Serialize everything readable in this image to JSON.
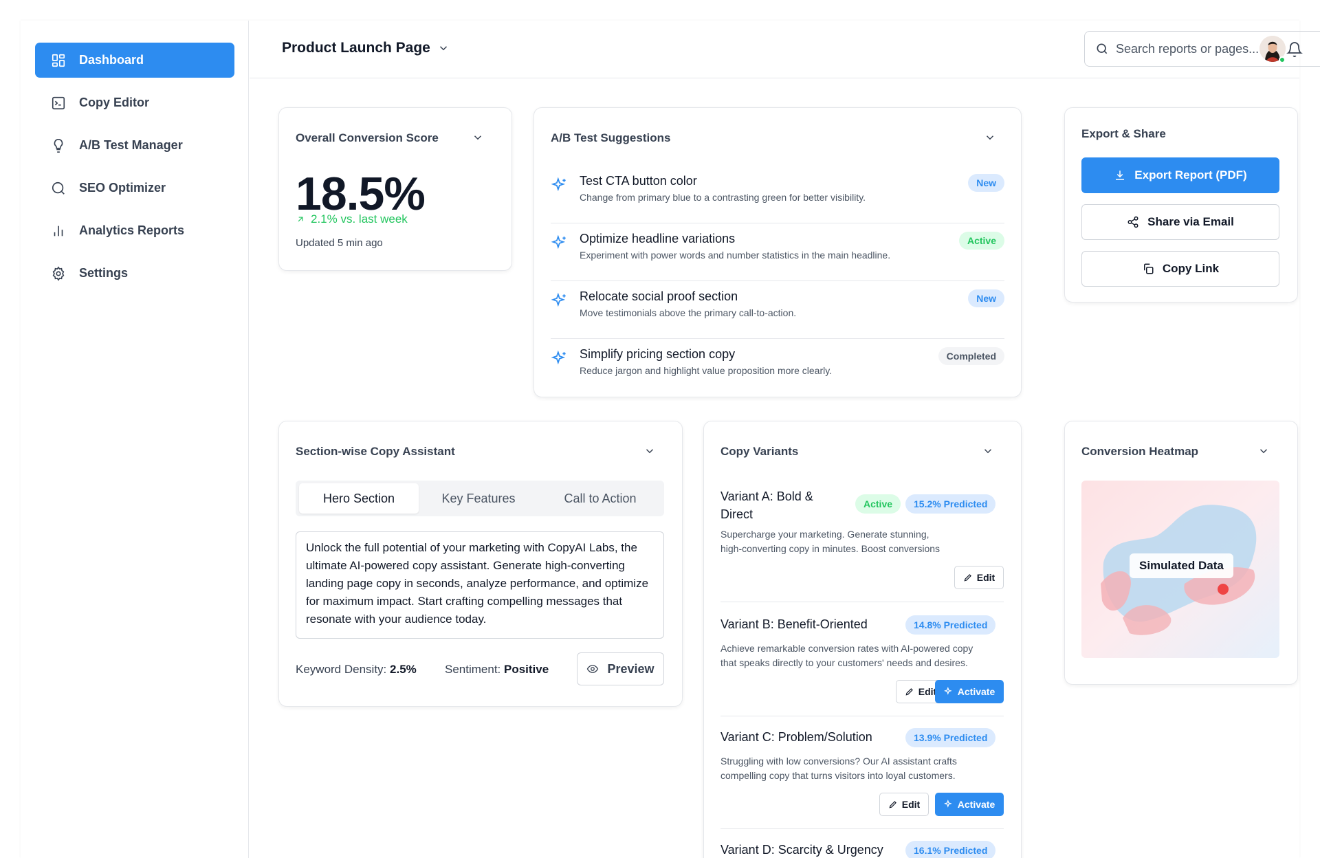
{
  "sidebar": {
    "items": [
      {
        "label": "Dashboard",
        "icon": "dashboard-icon",
        "active": true
      },
      {
        "label": "Copy Editor",
        "icon": "terminal-icon"
      },
      {
        "label": "A/B Test Manager",
        "icon": "lightbulb-icon"
      },
      {
        "label": "SEO Optimizer",
        "icon": "search-icon"
      },
      {
        "label": "Analytics Reports",
        "icon": "bar-chart-icon"
      },
      {
        "label": "Settings",
        "icon": "gear-icon"
      }
    ]
  },
  "header": {
    "page_title": "Product Launch Page",
    "search_placeholder": "Search reports or pages...",
    "status_color": "#22c55e"
  },
  "score_card": {
    "title": "Overall Conversion Score",
    "value": "18.5%",
    "delta": "2.1% vs. last week",
    "updated": "Updated 5 min ago"
  },
  "ab_card": {
    "title": "A/B Test Suggestions",
    "suggestions": [
      {
        "title": "Test CTA button color",
        "desc": "Change from primary blue to a contrasting green for better visibility.",
        "badge": "New",
        "badge_type": "new"
      },
      {
        "title": "Optimize headline variations",
        "desc": "Experiment with power words and number statistics in the main headline.",
        "badge": "Active",
        "badge_type": "active"
      },
      {
        "title": "Relocate social proof section",
        "desc": "Move testimonials above the primary call-to-action.",
        "badge": "New",
        "badge_type": "new"
      },
      {
        "title": "Simplify pricing section copy",
        "desc": "Reduce jargon and highlight value proposition more clearly.",
        "badge": "Completed",
        "badge_type": "completed"
      }
    ]
  },
  "export_card": {
    "title": "Export & Share",
    "export_label": "Export Report (PDF)",
    "share_label": "Share via Email",
    "copy_label": "Copy Link"
  },
  "assistant_card": {
    "title": "Section-wise Copy Assistant",
    "tabs": [
      "Hero Section",
      "Key Features",
      "Call to Action"
    ],
    "active_tab": 0,
    "copy_text": "Unlock the full potential of your marketing with CopyAI Labs, the ultimate AI-powered copy assistant. Generate high-converting landing page copy in seconds, analyze performance, and optimize for maximum impact. Start crafting compelling messages that resonate with your audience today.",
    "keyword_label": "Keyword Density:",
    "keyword_value": "2.5%",
    "sentiment_label": "Sentiment:",
    "sentiment_value": "Positive",
    "preview_label": "Preview"
  },
  "variants_card": {
    "title": "Copy Variants",
    "edit_label": "Edit",
    "activate_label": "Activate",
    "variants": [
      {
        "title_line1": "Variant A: Bold &",
        "title_line2": "Direct",
        "status": "Active",
        "predicted": "15.2% Predicted",
        "desc_line1": "Supercharge your marketing. Generate stunning,",
        "desc_line2": "high-converting copy in minutes. Boost conversions"
      },
      {
        "title": "Variant B: Benefit-Oriented",
        "predicted": "14.8% Predicted",
        "desc_line1": "Achieve remarkable conversion rates with AI-powered copy",
        "desc_line2": "that speaks directly to your customers' needs and desires."
      },
      {
        "title": "Variant C: Problem/Solution",
        "predicted": "13.9% Predicted",
        "desc_line1": "Struggling with low conversions? Our AI assistant crafts",
        "desc_line2": "compelling copy that turns visitors into loyal customers."
      },
      {
        "title": "Variant D: Scarcity & Urgency",
        "predicted": "16.1% Predicted"
      }
    ]
  },
  "heatmap_card": {
    "title": "Conversion Heatmap",
    "overlay_label": "Simulated Data"
  },
  "colors": {
    "accent": "#2d8cf0",
    "success": "#22c55e",
    "border": "#e5e7eb"
  }
}
